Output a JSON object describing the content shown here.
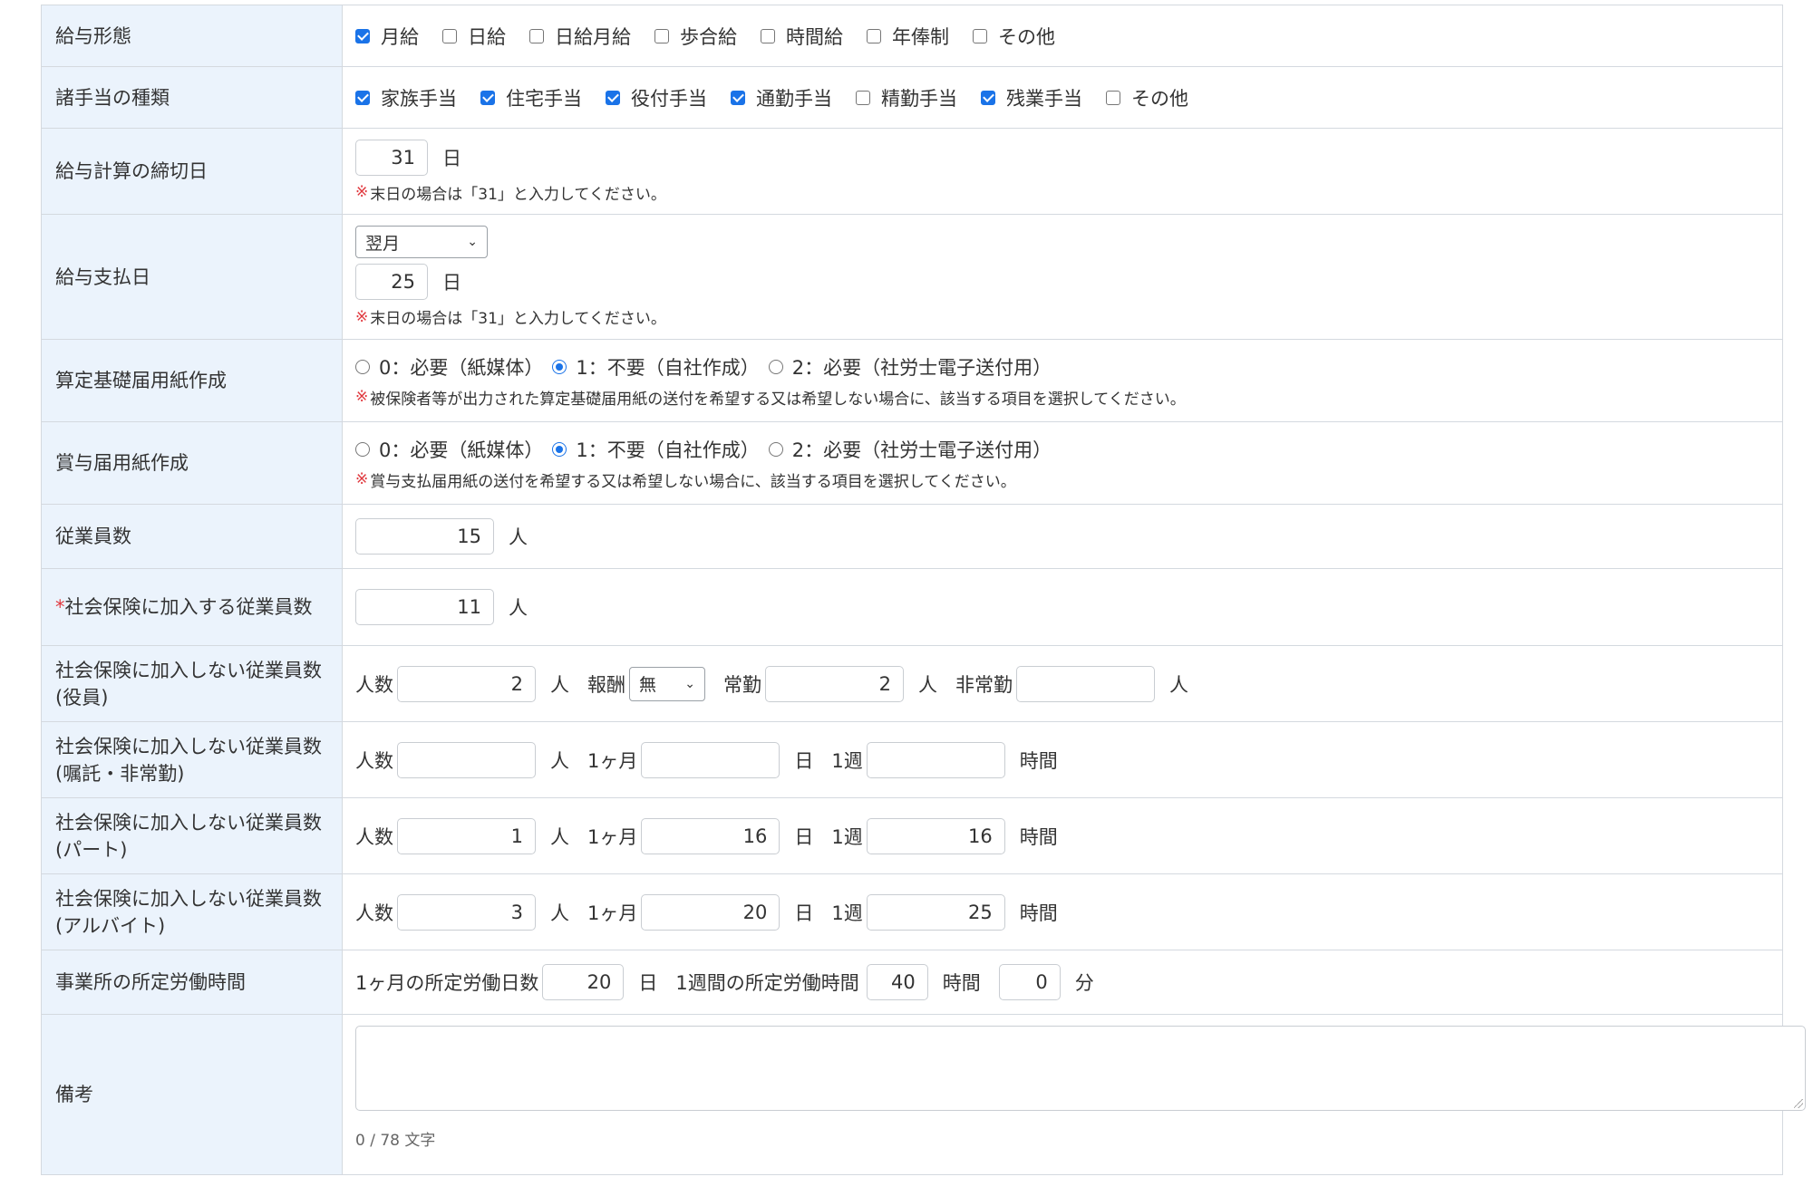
{
  "rows": {
    "pay_form": {
      "label": "給与形態",
      "options": [
        {
          "label": "月給",
          "checked": true
        },
        {
          "label": "日給",
          "checked": false
        },
        {
          "label": "日給月給",
          "checked": false
        },
        {
          "label": "歩合給",
          "checked": false
        },
        {
          "label": "時間給",
          "checked": false
        },
        {
          "label": "年俸制",
          "checked": false
        },
        {
          "label": "その他",
          "checked": false
        }
      ]
    },
    "allowances": {
      "label": "諸手当の種類",
      "options": [
        {
          "label": "家族手当",
          "checked": true
        },
        {
          "label": "住宅手当",
          "checked": true
        },
        {
          "label": "役付手当",
          "checked": true
        },
        {
          "label": "通勤手当",
          "checked": true
        },
        {
          "label": "精勤手当",
          "checked": false
        },
        {
          "label": "残業手当",
          "checked": true
        },
        {
          "label": "その他",
          "checked": false
        }
      ]
    },
    "closing_day": {
      "label": "給与計算の締切日",
      "value": "31",
      "unit": "日",
      "note_mark": "※",
      "note": "末日の場合は「31」と入力してください。"
    },
    "pay_day": {
      "label": "給与支払日",
      "month_select": "翌月",
      "value": "25",
      "unit": "日",
      "note_mark": "※",
      "note": "末日の場合は「31」と入力してください。"
    },
    "santei_form": {
      "label": "算定基礎届用紙作成",
      "options": [
        {
          "label": "0：必要（紙媒体）",
          "selected": false
        },
        {
          "label": "1：不要（自社作成）",
          "selected": true
        },
        {
          "label": "2：必要（社労士電子送付用）",
          "selected": false
        }
      ],
      "note_mark": "※",
      "note": "被保険者等が出力された算定基礎届用紙の送付を希望する又は希望しない場合に、該当する項目を選択してください。"
    },
    "bonus_form": {
      "label": "賞与届用紙作成",
      "options": [
        {
          "label": "0：必要（紙媒体）",
          "selected": false
        },
        {
          "label": "1：不要（自社作成）",
          "selected": true
        },
        {
          "label": "2：必要（社労士電子送付用）",
          "selected": false
        }
      ],
      "note_mark": "※",
      "note": "賞与支払届用紙の送付を希望する又は希望しない場合に、該当する項目を選択してください。"
    },
    "employees": {
      "label": "従業員数",
      "value": "15",
      "unit": "人"
    },
    "insured_employees": {
      "required_mark": "*",
      "label": "社会保険に加入する従業員数",
      "value": "11",
      "unit": "人"
    },
    "uninsured_officers": {
      "label": "社会保険に加入しない従業員数 (役員)",
      "count_label": "人数",
      "count_value": "2",
      "count_unit": "人",
      "pay_label": "報酬",
      "pay_select": "無",
      "fulltime_label": "常勤",
      "fulltime_value": "2",
      "fulltime_unit": "人",
      "parttime_label": "非常勤",
      "parttime_value": "",
      "parttime_unit": "人"
    },
    "uninsured_contract": {
      "label": "社会保険に加入しない従業員数 (嘱託・非常勤)",
      "count_label": "人数",
      "count_value": "",
      "count_unit": "人",
      "month_label": "1ヶ月",
      "month_value": "",
      "month_unit": "日",
      "week_label": "1週",
      "week_value": "",
      "week_unit": "時間"
    },
    "uninsured_part": {
      "label": "社会保険に加入しない従業員数 (パート)",
      "count_label": "人数",
      "count_value": "1",
      "count_unit": "人",
      "month_label": "1ヶ月",
      "month_value": "16",
      "month_unit": "日",
      "week_label": "1週",
      "week_value": "16",
      "week_unit": "時間"
    },
    "uninsured_arbeit": {
      "label": "社会保険に加入しない従業員数 (アルバイト)",
      "count_label": "人数",
      "count_value": "3",
      "count_unit": "人",
      "month_label": "1ヶ月",
      "month_value": "20",
      "month_unit": "日",
      "week_label": "1週",
      "week_value": "25",
      "week_unit": "時間"
    },
    "working_hours": {
      "label": "事業所の所定労働時間",
      "days_label": "1ヶ月の所定労働日数",
      "days_value": "20",
      "days_unit": "日",
      "hours_label": "1週間の所定労働時間",
      "hours_value": "40",
      "hours_unit": "時間",
      "minutes_value": "0",
      "minutes_unit": "分"
    },
    "remarks": {
      "label": "備考",
      "value": "",
      "counter": "0 / 78 文字"
    }
  },
  "colors": {
    "label_bg": "#ebf3fc",
    "border": "#d4d9df",
    "accent": "#1a73e8",
    "required": "#e0383e"
  }
}
